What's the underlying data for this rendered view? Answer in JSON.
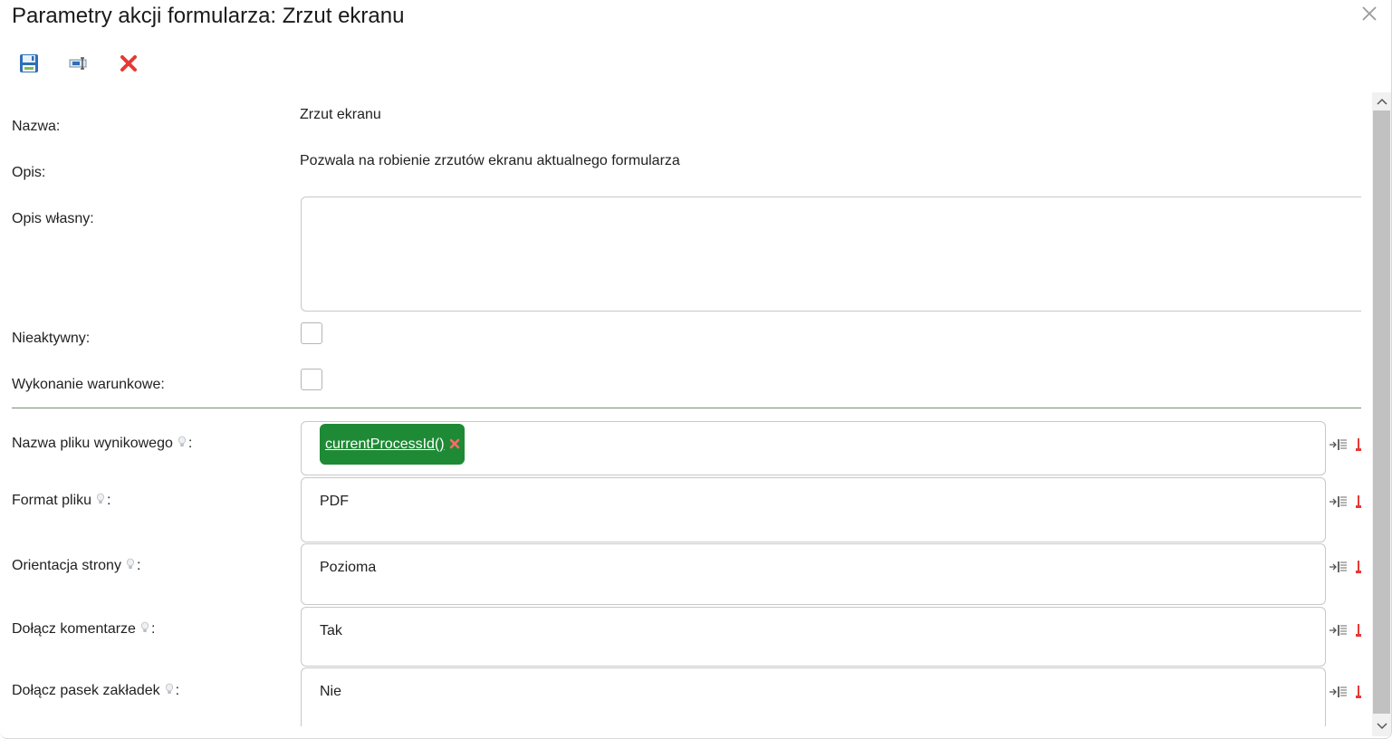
{
  "dialog": {
    "title": "Parametry akcji formularza: Zrzut ekranu"
  },
  "toolbar": {
    "icons": [
      "save-icon",
      "rename-icon",
      "delete-icon"
    ]
  },
  "form": {
    "name_label": "Nazwa:",
    "name_value": "Zrzut ekranu",
    "desc_label": "Opis:",
    "desc_value": "Pozwala na robienie zrzutów ekranu aktualnego formularza",
    "own_desc_label": "Opis własny:",
    "own_desc_value": "",
    "inactive_label": "Nieaktywny:",
    "inactive_checked": false,
    "conditional_label": "Wykonanie warunkowe:",
    "conditional_checked": false
  },
  "params": [
    {
      "label": "Nazwa pliku wynikowego",
      "suffix": ":",
      "chip": "currentProcessId()"
    },
    {
      "label": "Format pliku",
      "suffix": ":",
      "value": "PDF"
    },
    {
      "label": "Orientacja strony",
      "suffix": ":",
      "value": "Pozioma"
    },
    {
      "label": "Dołącz komentarze",
      "suffix": ":",
      "value": "Tak"
    },
    {
      "label": "Dołącz pasek zakładek",
      "suffix": ":",
      "value": "Nie"
    }
  ],
  "colors": {
    "chip_green": "#1e8a35",
    "delete_red": "#e53935",
    "save_blue": "#2f6fb5"
  }
}
